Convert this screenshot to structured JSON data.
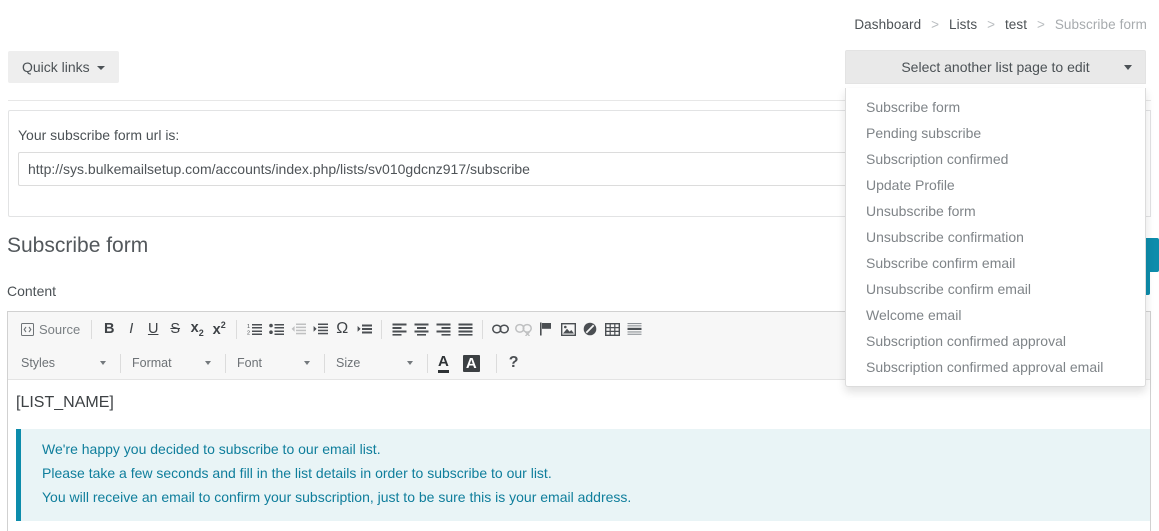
{
  "breadcrumb": {
    "items": [
      {
        "label": "Dashboard",
        "active": false
      },
      {
        "label": "Lists",
        "active": false
      },
      {
        "label": "test",
        "active": false
      },
      {
        "label": "Subscribe form",
        "active": true
      }
    ],
    "separator": ">"
  },
  "toolbar": {
    "quick_links_label": "Quick links"
  },
  "list_page_dropdown": {
    "toggle_label": "Select another list page to edit",
    "open": true,
    "options": [
      "Subscribe form",
      "Pending subscribe",
      "Subscription confirmed",
      "Update Profile",
      "Unsubscribe form",
      "Unsubscribe confirmation",
      "Subscribe confirm email",
      "Unsubscribe confirm email",
      "Welcome email",
      "Subscription confirmed approval",
      "Subscription confirmed approval email"
    ]
  },
  "url_panel": {
    "label": "Your subscribe form url is:",
    "url_value": "http://sys.bulkemailsetup.com/accounts/index.php/lists/sv010gdcnz917/subscribe",
    "url_placeholder": ""
  },
  "form": {
    "section_title": "Subscribe form",
    "content_label": "Content"
  },
  "editor": {
    "row1": [
      {
        "name": "source-button",
        "label": "Source",
        "icon": "source-icon",
        "disabled": false
      },
      {
        "name": "separator",
        "label": "",
        "icon": "separator",
        "disabled": false
      },
      {
        "name": "bold-button",
        "label": "B",
        "icon": "bold-icon",
        "disabled": false
      },
      {
        "name": "italic-button",
        "label": "I",
        "icon": "italic-icon",
        "disabled": false
      },
      {
        "name": "underline-button",
        "label": "U",
        "icon": "underline-icon",
        "disabled": false
      },
      {
        "name": "strikethrough-button",
        "label": "S",
        "icon": "strikethrough-icon",
        "disabled": false
      },
      {
        "name": "subscript-button",
        "label": "x2",
        "icon": "subscript-icon",
        "disabled": false
      },
      {
        "name": "superscript-button",
        "label": "x2",
        "icon": "superscript-icon",
        "disabled": false
      },
      {
        "name": "separator",
        "label": "",
        "icon": "separator",
        "disabled": false
      },
      {
        "name": "numbered-list-button",
        "label": "",
        "icon": "numbered-list-icon",
        "disabled": false
      },
      {
        "name": "bulleted-list-button",
        "label": "",
        "icon": "bulleted-list-icon",
        "disabled": false
      },
      {
        "name": "outdent-button",
        "label": "",
        "icon": "outdent-icon",
        "disabled": true
      },
      {
        "name": "indent-button",
        "label": "",
        "icon": "indent-icon",
        "disabled": false
      },
      {
        "name": "special-character-button",
        "label": "Ω",
        "icon": "omega-icon",
        "disabled": false
      },
      {
        "name": "blockquote-button",
        "label": "",
        "icon": "blockquote-icon",
        "disabled": false
      },
      {
        "name": "separator",
        "label": "",
        "icon": "separator",
        "disabled": false
      },
      {
        "name": "align-left-button",
        "label": "",
        "icon": "align-left-icon",
        "disabled": false
      },
      {
        "name": "align-center-button",
        "label": "",
        "icon": "align-center-icon",
        "disabled": false
      },
      {
        "name": "align-right-button",
        "label": "",
        "icon": "align-right-icon",
        "disabled": false
      },
      {
        "name": "align-justify-button",
        "label": "",
        "icon": "align-justify-icon",
        "disabled": false
      },
      {
        "name": "separator",
        "label": "",
        "icon": "separator",
        "disabled": false
      },
      {
        "name": "link-button",
        "label": "",
        "icon": "link-icon",
        "disabled": false
      },
      {
        "name": "unlink-button",
        "label": "",
        "icon": "unlink-icon",
        "disabled": true
      },
      {
        "name": "anchor-button",
        "label": "",
        "icon": "flag-icon",
        "disabled": false
      },
      {
        "name": "image-button",
        "label": "",
        "icon": "image-icon",
        "disabled": false
      },
      {
        "name": "page-break-button",
        "label": "",
        "icon": "no-entry-icon",
        "disabled": false
      },
      {
        "name": "table-button",
        "label": "",
        "icon": "table-icon",
        "disabled": false
      },
      {
        "name": "horizontal-rule-button",
        "label": "",
        "icon": "horizontal-rule-icon",
        "disabled": false
      }
    ],
    "combos": [
      {
        "name": "styles-select",
        "label": "Styles"
      },
      {
        "name": "format-select",
        "label": "Format"
      },
      {
        "name": "font-select",
        "label": "Font"
      },
      {
        "name": "size-select",
        "label": "Size"
      }
    ],
    "text_color_label": "A",
    "bg_color_label": "A",
    "help_label": "?",
    "body": {
      "placeholder_tag": "[LIST_NAME]",
      "quote_lines": [
        "We're happy you decided to subscribe to our email list.",
        "Please take a few seconds and fill in the list details in order to subscribe to our list.",
        "You will receive an email to confirm your subscription, just to be sure this is your email address."
      ]
    }
  },
  "colors": {
    "accent_teal": "#0d8cab",
    "quote_bg": "#e9f4f6",
    "quote_text": "#0f7e9c",
    "toolbar_bg": "#f7f7f7",
    "button_gray": "#eeeeee"
  }
}
